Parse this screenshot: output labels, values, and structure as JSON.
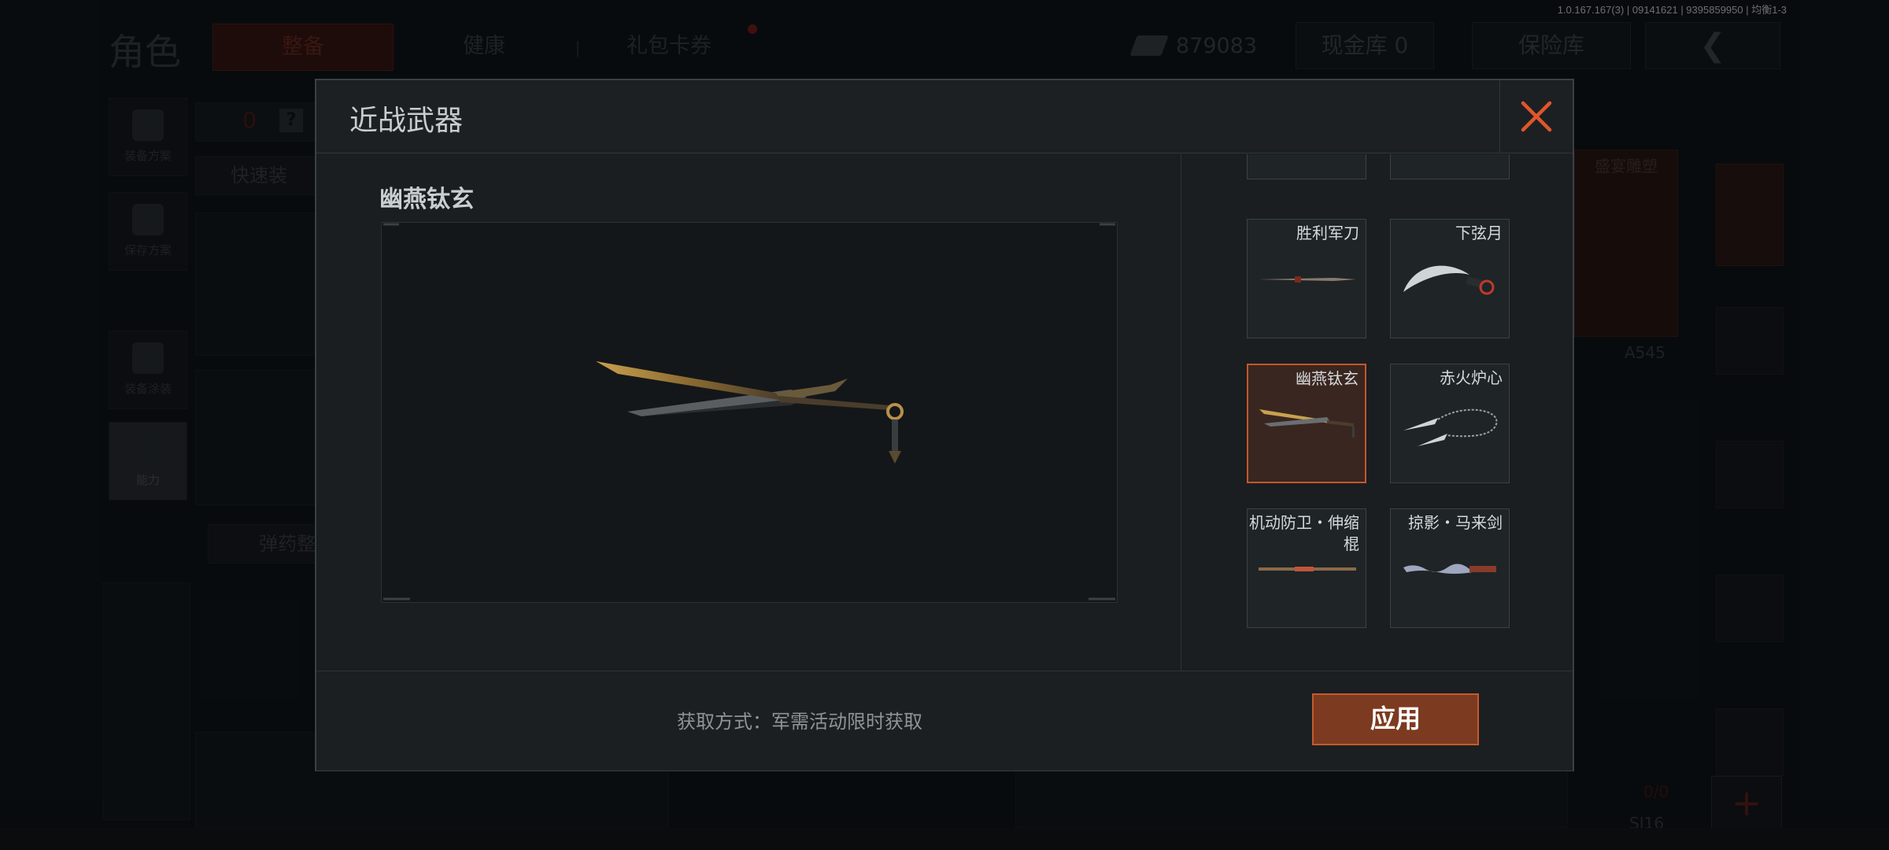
{
  "build_info": "1.0.167.167(3) | 09141621 | 9395859950 | 均衡1-3",
  "background": {
    "page_title": "角色",
    "tabs": [
      {
        "label": "整备",
        "active": true
      },
      {
        "label": "健康",
        "active": false
      },
      {
        "label": "礼包卡券",
        "active": false
      }
    ],
    "currency_amount": "879083",
    "cash_vault_label": "现金库 0",
    "safe_vault_label": "保险库",
    "left_nav": [
      {
        "label": "装备方案",
        "icon": "backpack-icon"
      },
      {
        "label": "保存方案",
        "icon": "download-icon"
      },
      {
        "label": "装备涂装",
        "icon": "soldier-icon"
      },
      {
        "label": "能力",
        "icon": "lightning-hex-icon"
      }
    ],
    "bag_count": "0",
    "help_mark": "?",
    "quick_equip_label": "快速装",
    "ammo_label": "弹药整",
    "painted_label": "盛宴雕塑",
    "weapon_code_1": "A545",
    "weapon_code_2": "SJ16",
    "ammo_fraction": "0/0"
  },
  "modal": {
    "title": "近战武器",
    "selected_weapon_name": "幽燕钛玄",
    "obtain_text": "获取方式：军需活动限时获取",
    "apply_label": "应用",
    "items": [
      {
        "name": "胜利军刀",
        "selected": false
      },
      {
        "name": "下弦月",
        "selected": false
      },
      {
        "name": "幽燕钛玄",
        "selected": true
      },
      {
        "name": "赤火炉心",
        "selected": false
      },
      {
        "name": "机动防卫・伸缩棍",
        "selected": false
      },
      {
        "name": "掠影・马来剑",
        "selected": false
      }
    ]
  },
  "colors": {
    "accent_orange": "#c4572a",
    "apply_fill": "#7c3a20",
    "close_icon": "#e0562a"
  }
}
